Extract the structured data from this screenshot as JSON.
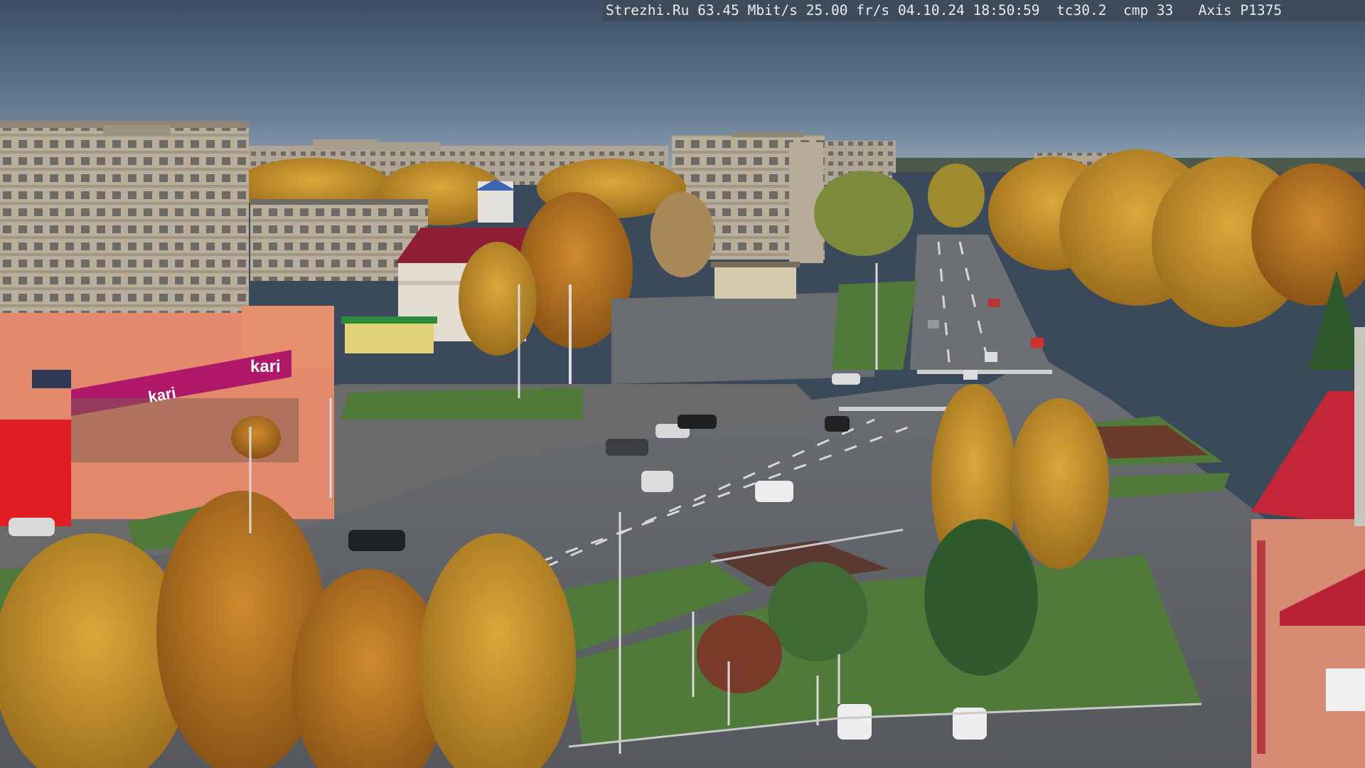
{
  "camera_overlay": {
    "site": "Strezhi.Ru",
    "bitrate": "63.45 Mbit/s",
    "framerate": "25.00 fr/s",
    "date": "04.10.24",
    "time": "18:50:59",
    "tc": "tc30.2",
    "cmp": "cmp 33",
    "camera_model": "Axis P1375"
  },
  "storefront_signs": {
    "store_brand": "kari",
    "store_banner_script": "kari"
  },
  "colors": {
    "sky_top": "#3d5068",
    "sky_horizon": "#8da2b6",
    "foliage_gold": "#c9952a",
    "foliage_orange": "#c77a20",
    "kari_magenta": "#b0196a",
    "roof_red": "#b3223a",
    "asphalt": "#5a5e62",
    "grass": "#4f7a3a",
    "overlay_bg": "#3e4b5a"
  }
}
